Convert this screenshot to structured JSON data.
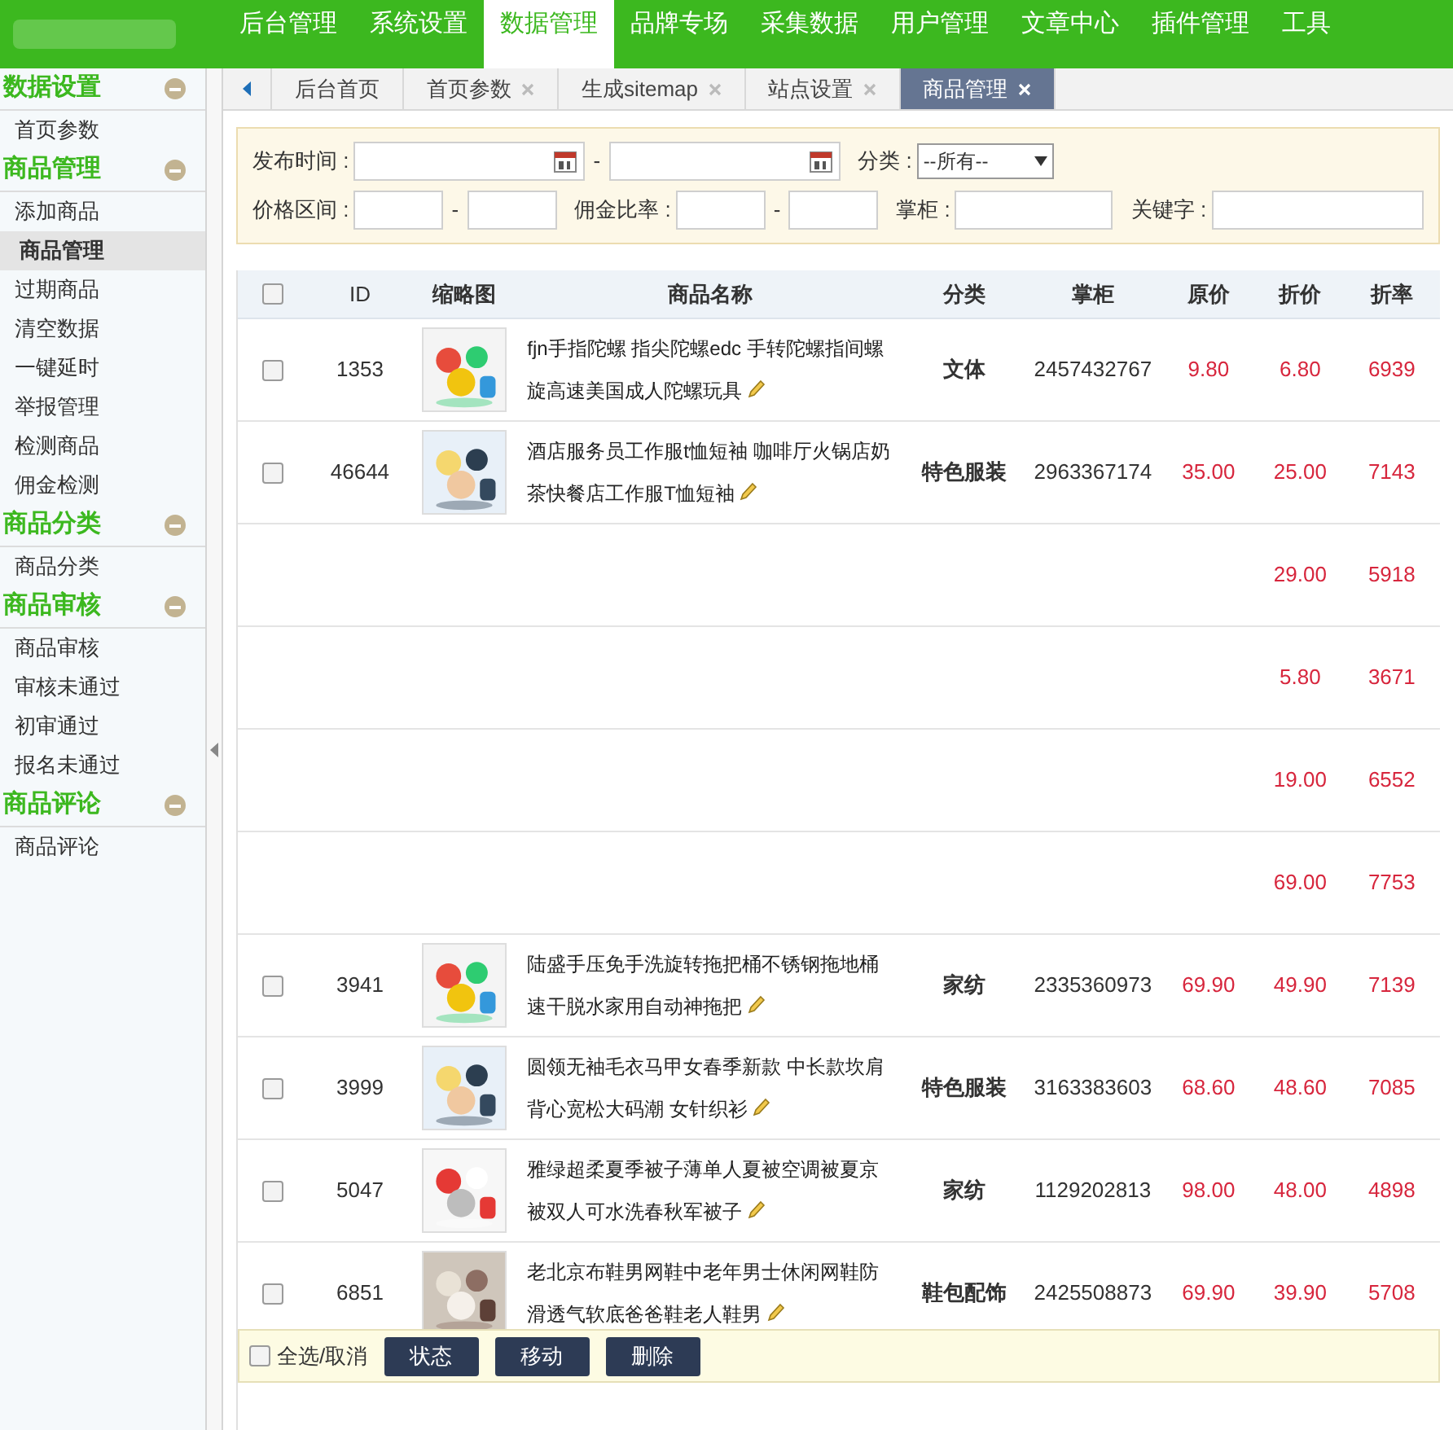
{
  "nav": [
    {
      "label": "后台管理",
      "selected": false
    },
    {
      "label": "系统设置",
      "selected": false
    },
    {
      "label": "数据管理",
      "selected": true
    },
    {
      "label": "品牌专场",
      "selected": false
    },
    {
      "label": "采集数据",
      "selected": false
    },
    {
      "label": "用户管理",
      "selected": false
    },
    {
      "label": "文章中心",
      "selected": false
    },
    {
      "label": "插件管理",
      "selected": false
    },
    {
      "label": "工具",
      "selected": false
    }
  ],
  "sidebar": [
    {
      "title": "数据设置",
      "expanded": true,
      "items": [
        {
          "label": "首页参数",
          "selected": false
        }
      ]
    },
    {
      "title": "商品管理",
      "expanded": true,
      "items": [
        {
          "label": "添加商品",
          "selected": false
        },
        {
          "label": "商品管理",
          "selected": true
        },
        {
          "label": "过期商品",
          "selected": false
        },
        {
          "label": "清空数据",
          "selected": false
        },
        {
          "label": "一键延时",
          "selected": false
        },
        {
          "label": "举报管理",
          "selected": false
        },
        {
          "label": "检测商品",
          "selected": false
        },
        {
          "label": "佣金检测",
          "selected": false
        }
      ]
    },
    {
      "title": "商品分类",
      "expanded": true,
      "items": [
        {
          "label": "商品分类",
          "selected": false
        }
      ]
    },
    {
      "title": "商品审核",
      "expanded": true,
      "items": [
        {
          "label": "商品审核",
          "selected": false
        },
        {
          "label": "审核未通过",
          "selected": false
        },
        {
          "label": "初审通过",
          "selected": false
        },
        {
          "label": "报名未通过",
          "selected": false
        }
      ]
    },
    {
      "title": "商品评论",
      "expanded": true,
      "items": [
        {
          "label": "商品评论",
          "selected": false
        }
      ]
    }
  ],
  "tabs": [
    {
      "label": "后台首页",
      "closable": false,
      "selected": false
    },
    {
      "label": "首页参数",
      "closable": true,
      "selected": false
    },
    {
      "label": "生成sitemap",
      "closable": true,
      "selected": false
    },
    {
      "label": "站点设置",
      "closable": true,
      "selected": false
    },
    {
      "label": "商品管理",
      "closable": true,
      "selected": true
    }
  ],
  "filters": {
    "publish_time_label": "发布时间 :",
    "range_dash": "-",
    "category_label": "分类 :",
    "category_value": "--所有--",
    "price_label": "价格区间 :",
    "commission_label": "佣金比率 :",
    "shop_label": "掌柜 :",
    "keyword_label": "关键字 :"
  },
  "table": {
    "header_checked": false,
    "columns": [
      "ID",
      "缩略图",
      "商品名称",
      "分类",
      "掌柜",
      "原价",
      "折价",
      "折率"
    ],
    "rows": [
      {
        "checked": false,
        "id": "1353",
        "name": "fjn手指陀螺 指尖陀螺edc 手转陀螺指间螺旋高速美国成人陀螺玩具",
        "category": "文体",
        "shop": "2457432767",
        "price": "9.80",
        "discount": "6.80",
        "rate": "6939"
      },
      {
        "checked": false,
        "id": "46644",
        "name": "酒店服务员工作服t恤短袖 咖啡厅火锅店奶茶快餐店工作服T恤短袖",
        "category": "特色服装",
        "shop": "2963367174",
        "price": "35.00",
        "discount": "25.00",
        "rate": "7143"
      },
      {
        "discount": "29.00",
        "rate": "5918"
      },
      {
        "discount": "5.80",
        "rate": "3671"
      },
      {
        "discount": "19.00",
        "rate": "6552"
      },
      {
        "discount": "69.00",
        "rate": "7753"
      },
      {
        "checked": false,
        "id": "3941",
        "name": "陆盛手压免手洗旋转拖把桶不锈钢拖地桶速干脱水家用自动神拖把",
        "category": "家纺",
        "shop": "2335360973",
        "price": "69.90",
        "discount": "49.90",
        "rate": "7139"
      },
      {
        "checked": false,
        "id": "3999",
        "name": "圆领无袖毛衣马甲女春季新款 中长款坎肩背心宽松大码潮 女针织衫",
        "category": "特色服装",
        "shop": "3163383603",
        "price": "68.60",
        "discount": "48.60",
        "rate": "7085"
      },
      {
        "checked": false,
        "id": "5047",
        "name": "雅绿超柔夏季被子薄单人夏被空调被夏京被双人可水洗春秋军被子",
        "category": "家纺",
        "shop": "1129202813",
        "price": "98.00",
        "discount": "48.00",
        "rate": "4898"
      },
      {
        "checked": false,
        "id": "6851",
        "name": "老北京布鞋男网鞋中老年男士休闲网鞋防滑透气软底爸爸鞋老人鞋男",
        "category": "鞋包配饰",
        "shop": "2425508873",
        "price": "69.90",
        "discount": "39.90",
        "rate": "5708"
      }
    ]
  },
  "footer": {
    "select_all": {
      "label": "全选/取消",
      "checked": false
    },
    "buttons": [
      "状态",
      "移动",
      "删除"
    ]
  }
}
